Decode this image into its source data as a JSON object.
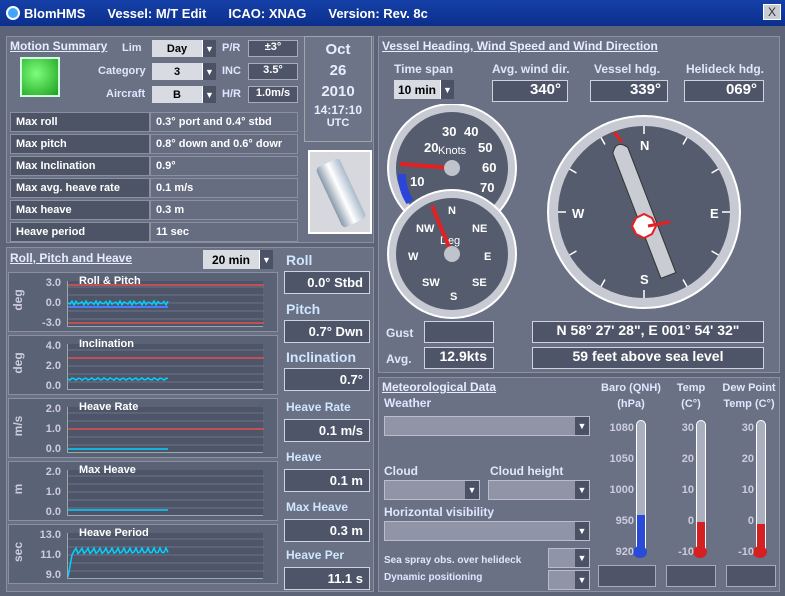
{
  "titlebar": {
    "app": "BlomHMS",
    "vessel": "Vessel: M/T Edit",
    "icao": "ICAO: XNAG",
    "version": "Version: Rev. 8c",
    "close": "X"
  },
  "motion": {
    "title": "Motion Summary",
    "lim_label": "Lim",
    "lim_value": "Day",
    "pr_label": "P/R",
    "pr_value": "±3°",
    "category_label": "Category",
    "category_value": "3",
    "inc_label": "INC",
    "inc_value": "3.5°",
    "aircraft_label": "Aircraft",
    "aircraft_value": "B",
    "hr_label": "H/R",
    "hr_value": "1.0m/s",
    "rows": [
      {
        "label": "Max roll",
        "value": "0.3° port and 0.4° stbd"
      },
      {
        "label": "Max pitch",
        "value": "0.8° down and 0.6° dowr"
      },
      {
        "label": "Max Inclination",
        "value": "0.9°"
      },
      {
        "label": "Max avg. heave rate",
        "value": "0.1 m/s"
      },
      {
        "label": "Max heave",
        "value": "0.3 m"
      },
      {
        "label": "Heave period",
        "value": "11 sec"
      }
    ]
  },
  "date": {
    "month": "Oct",
    "day": "26",
    "year": "2010",
    "time": "14:17:10",
    "zone": "UTC"
  },
  "rph": {
    "title": "Roll, Pitch and Heave",
    "span": "20 min",
    "charts": [
      {
        "title": "Roll & Pitch",
        "unit": "deg",
        "ticks": [
          "3.0",
          "0.0",
          "-3.0"
        ]
      },
      {
        "title": "Inclination",
        "unit": "deg",
        "ticks": [
          "4.0",
          "2.0",
          "0.0"
        ]
      },
      {
        "title": "Heave Rate",
        "unit": "m/s",
        "ticks": [
          "2.0",
          "1.0",
          "0.0"
        ]
      },
      {
        "title": "Max Heave",
        "unit": "m",
        "ticks": [
          "2.0",
          "1.0",
          "0.0"
        ]
      },
      {
        "title": "Heave Period",
        "unit": "sec",
        "ticks": [
          "13.0",
          "11.0",
          "9.0"
        ]
      }
    ]
  },
  "readouts": [
    {
      "label": "Roll",
      "value": "0.0° Stbd"
    },
    {
      "label": "Pitch",
      "value": "0.7° Dwn"
    },
    {
      "label": "Inclination",
      "value": "0.7°"
    },
    {
      "label": "Heave Rate",
      "value": "0.1 m/s"
    },
    {
      "label": "Heave",
      "value": "0.1 m"
    },
    {
      "label": "Max Heave",
      "value": "0.3 m"
    },
    {
      "label": "Heave Per",
      "value": "11.1 s"
    }
  ],
  "wind": {
    "title": "Vessel Heading, Wind Speed and Wind Direction",
    "span_label": "Time span",
    "span_value": "10 min",
    "avg_dir_label": "Avg. wind dir.",
    "avg_dir_value": "340°",
    "vessel_hdg_label": "Vessel hdg.",
    "vessel_hdg_value": "339°",
    "helideck_hdg_label": "Helideck hdg.",
    "helideck_hdg_value": "069°",
    "gust_label": "Gust",
    "gust_value": "",
    "avg_label": "Avg.",
    "avg_value": "12.9kts",
    "position": "N 58° 27' 28\", E 001° 54' 32\"",
    "altitude": "59 feet above sea level",
    "speed_ticks": [
      "10",
      "20",
      "30",
      "40",
      "50",
      "60",
      "70"
    ],
    "speed_unit": "Knots",
    "dir_ticks": [
      "N",
      "NE",
      "E",
      "SE",
      "S",
      "SW",
      "W",
      "NW"
    ],
    "dir_unit": "Deg",
    "compass_ticks": [
      "N",
      "E",
      "S",
      "W"
    ]
  },
  "met": {
    "title": "Meteorological Data",
    "weather_label": "Weather",
    "cloud_label": "Cloud",
    "cloud_height_label": "Cloud height",
    "visibility_label": "Horizontal visibility",
    "spray_label": "Sea spray obs. over helideck",
    "dp_label": "Dynamic positioning",
    "baro_label": "Baro (QNH)",
    "baro_unit": "(hPa)",
    "temp_label": "Temp",
    "temp_unit": "(C°)",
    "dew_label": "Dew Point",
    "dew_unit": "Temp (C°)",
    "baro_ticks": [
      "1080",
      "1050",
      "1000",
      "950",
      "920"
    ],
    "temp_ticks": [
      "30",
      "20",
      "10",
      "0",
      "-10"
    ],
    "dew_ticks": [
      "30",
      "20",
      "10",
      "0",
      "-10"
    ]
  }
}
